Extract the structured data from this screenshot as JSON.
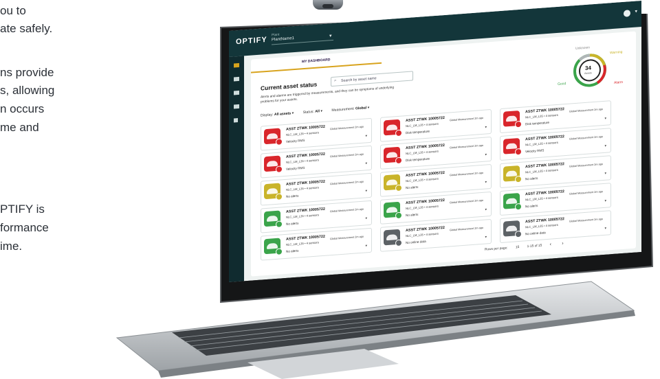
{
  "side_text": [
    "ou to",
    "ate safely.",
    "ns provide",
    "s, allowing",
    "n occurs",
    "me and",
    "PTIFY is",
    "formance",
    "ime."
  ],
  "app": {
    "logo": "OPTIFY",
    "plant_label": "Plant",
    "plant_value": "PlantName1",
    "tab": "MY DASHBOARD",
    "title": "Current asset status",
    "search_placeholder": "Search by asset name",
    "description": "Alerts and alarms are triggered by measurements, and they can be symptoms of underlying problems for your assets.",
    "filters": {
      "display_label": "Display:",
      "display_value": "All assets",
      "status_label": "Status:",
      "status_value": "All",
      "measurement_label": "Measurement:",
      "measurement_value": "Global"
    },
    "gauge": {
      "value": "34",
      "unit": "Assets",
      "labels": {
        "unknown": "Unknown",
        "warning": "Warning",
        "good": "Good",
        "alarm": "Alarm"
      }
    },
    "colors": {
      "topbar": "#13363a",
      "accent": "#d8a31d",
      "alarm": "#d9262b",
      "warning": "#c9b42a",
      "good": "#3aa44a",
      "offline": "#5d6266"
    },
    "cards": [
      {
        "name": "ASST ZTWK 10005722",
        "meta": "NLC_LM_L35   • 4 sensors",
        "meas": "Global Measurement  2m ago",
        "alert": "Velocity RMS",
        "status": "alarm"
      },
      {
        "name": "ASST ZTWK 10005722",
        "meta": "NLC_LM_L35   • 4 sensors",
        "meas": "Global Measurement  2m ago",
        "alert": "Disk temperature",
        "status": "alarm"
      },
      {
        "name": "ASST ZTWK 10005722",
        "meta": "NLC_LM_L35   • 4 sensors",
        "meas": "Global Measurement  2m ago",
        "alert": "Disk temperature",
        "status": "alarm"
      },
      {
        "name": "ASST ZTWK 10005722",
        "meta": "NLC_LM_L35   • 4 sensors",
        "meas": "Global Measurement  2m ago",
        "alert": "Velocity RMS",
        "status": "alarm"
      },
      {
        "name": "ASST ZTWK 10005722",
        "meta": "NLC_LM_L35   • 4 sensors",
        "meas": "Global Measurement  2m ago",
        "alert": "Disk temperature",
        "status": "alarm"
      },
      {
        "name": "ASST ZTWK 10005722",
        "meta": "NLC_LM_L35   • 4 sensors",
        "meas": "Global Measurement  2m ago",
        "alert": "Velocity RMS",
        "status": "alarm"
      },
      {
        "name": "ASST ZTWK 10005722",
        "meta": "NLC_LM_L35   • 4 sensors",
        "meas": "Global Measurement  2m ago",
        "alert": "No alerts",
        "status": "warning"
      },
      {
        "name": "ASST ZTWK 10005722",
        "meta": "NLC_LM_L35   • 4 sensors",
        "meas": "Global Measurement  2m ago",
        "alert": "No alerts",
        "status": "warning"
      },
      {
        "name": "ASST ZTWK 10005722",
        "meta": "NLC_LM_L35   • 4 sensors",
        "meas": "Global Measurement  2m ago",
        "alert": "No alerts",
        "status": "warning"
      },
      {
        "name": "ASST ZTWK 10005722",
        "meta": "NLC_LM_L35   • 4 sensors",
        "meas": "Global Measurement  2m ago",
        "alert": "No alerts",
        "status": "good"
      },
      {
        "name": "ASST ZTWK 10005722",
        "meta": "NLC_LM_L35   • 4 sensors",
        "meas": "Global Measurement  2m ago",
        "alert": "No alerts",
        "status": "good"
      },
      {
        "name": "ASST ZTWK 10005722",
        "meta": "NLC_LM_L35   • 4 sensors",
        "meas": "Global Measurement  2m ago",
        "alert": "No alerts",
        "status": "good"
      },
      {
        "name": "ASST ZTWK 10005722",
        "meta": "NLC_LM_L35   • 4 sensors",
        "meas": "Global Measurement  2m ago",
        "alert": "No alerts",
        "status": "good"
      },
      {
        "name": "ASST ZTWK 10005722",
        "meta": "NLC_LM_L35   • 4 sensors",
        "meas": "Global Measurement  2m ago",
        "alert": "No online data",
        "status": "offline"
      },
      {
        "name": "ASST ZTWK 10005722",
        "meta": "NLC_LM_L35   • 4 sensors",
        "meas": "Global Measurement  2m ago",
        "alert": "No online data",
        "status": "offline"
      }
    ],
    "pager": {
      "rows_label": "Rows per page:",
      "rows_value": "15",
      "range": "1-15 of 15",
      "prev": "‹",
      "next": "›"
    }
  }
}
